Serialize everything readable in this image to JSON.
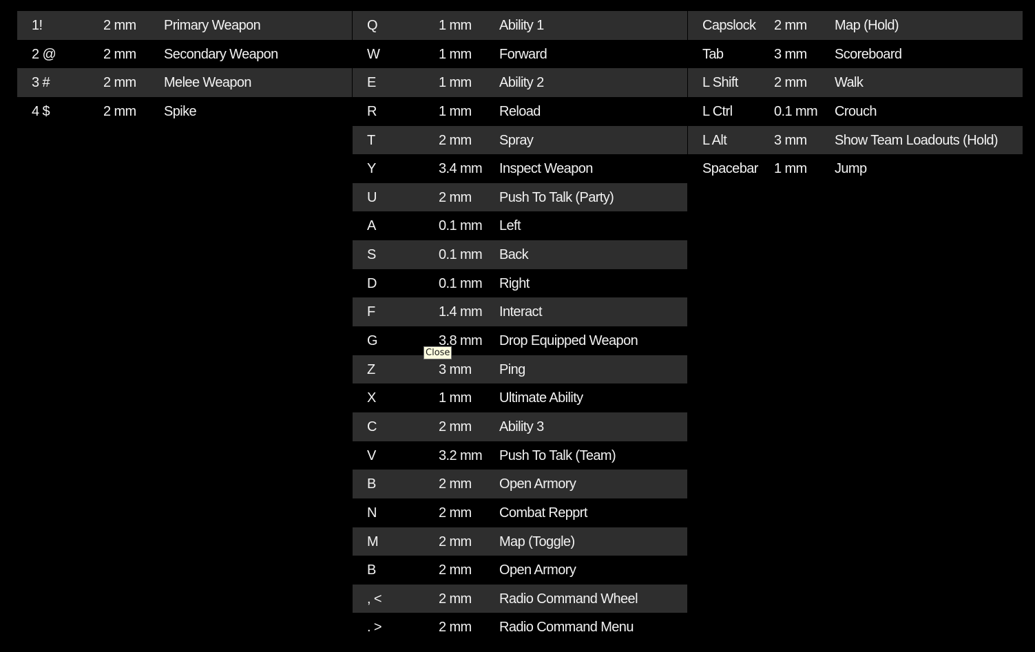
{
  "tables": [
    [
      [
        "1!",
        "2 mm",
        "Primary Weapon"
      ],
      [
        "2 @",
        "2 mm",
        "Secondary Weapon"
      ],
      [
        "3 #",
        "2 mm",
        "Melee Weapon"
      ],
      [
        "4 $",
        "2 mm",
        "Spike"
      ]
    ],
    [
      [
        "Q",
        "1 mm",
        "Ability 1"
      ],
      [
        "W",
        "1 mm",
        "Forward"
      ],
      [
        "E",
        "1 mm",
        "Ability 2"
      ],
      [
        "R",
        "1 mm",
        "Reload"
      ],
      [
        "T",
        "2  mm",
        "Spray"
      ],
      [
        "Y",
        "3.4 mm",
        "Inspect Weapon"
      ],
      [
        "U",
        "2 mm",
        "Push To Talk (Party)"
      ],
      [
        "A",
        "0.1 mm",
        "Left"
      ],
      [
        "S",
        "0.1 mm",
        "Back"
      ],
      [
        "D",
        "0.1 mm",
        "Right"
      ],
      [
        "F",
        "1.4  mm",
        "Interact"
      ],
      [
        "G",
        "3.8 mm",
        "Drop Equipped Weapon"
      ],
      [
        "Z",
        "3 mm",
        "Ping"
      ],
      [
        "X",
        "1 mm",
        "Ultimate Ability"
      ],
      [
        "C",
        "2 mm",
        "Ability 3"
      ],
      [
        "V",
        "3.2  mm",
        "Push To Talk (Team)"
      ],
      [
        "B",
        "2 mm",
        "Open Armory"
      ],
      [
        "N",
        "2 mm",
        "Combat Repprt"
      ],
      [
        "M",
        "2 mm",
        "Map (Toggle)"
      ],
      [
        "B",
        "2 mm",
        "Open Armory"
      ],
      [
        ", <",
        "2 mm",
        "Radio Command Wheel"
      ],
      [
        ". >",
        "2 mm",
        "Radio Command Menu"
      ]
    ],
    [
      [
        "Capslock",
        "2 mm",
        "Map (Hold)"
      ],
      [
        "Tab",
        "3 mm",
        "Scoreboard"
      ],
      [
        "L Shift",
        "2 mm",
        "Walk"
      ],
      [
        "L Ctrl",
        "0.1 mm",
        "Crouch"
      ],
      [
        "L Alt",
        "3 mm",
        "Show Team Loadouts (Hold)"
      ],
      [
        "Spacebar",
        "1 mm",
        "Jump"
      ]
    ]
  ],
  "tooltip": "Close"
}
